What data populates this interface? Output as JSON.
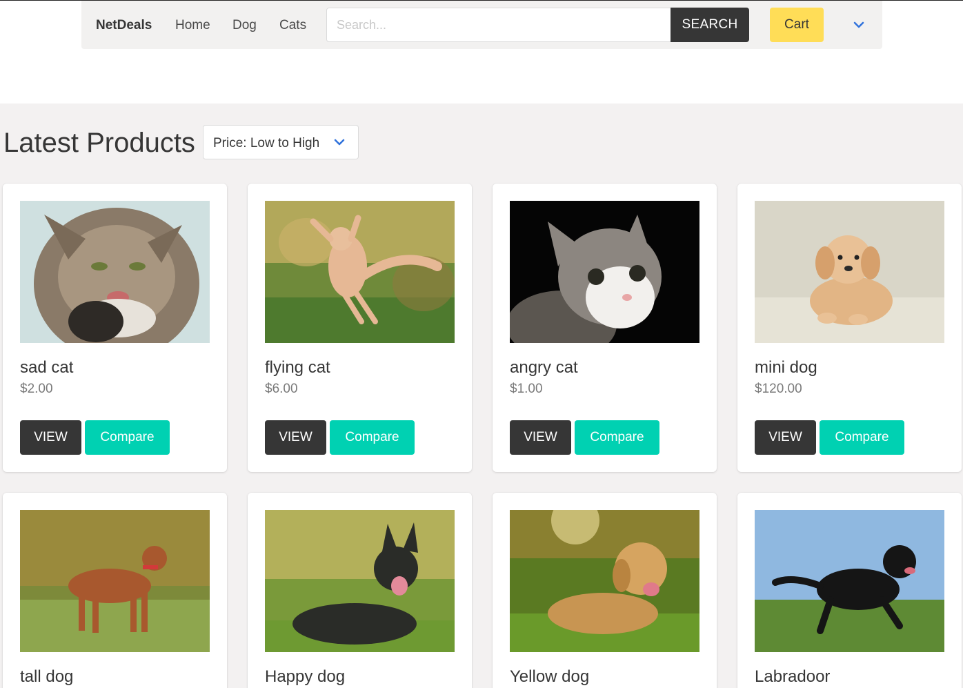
{
  "navbar": {
    "brand": "NetDeals",
    "links": [
      "Home",
      "Dog",
      "Cats"
    ],
    "search_placeholder": "Search...",
    "search_value": "",
    "search_button": "SEARCH",
    "cart_button": "Cart",
    "menu_icon": "chevron-down-icon"
  },
  "main": {
    "heading": "Latest Products",
    "sort": {
      "selected": "Price: Low to High",
      "icon": "chevron-down-icon"
    }
  },
  "products": [
    {
      "title": "sad cat",
      "price": "$2.00",
      "view": "VIEW",
      "compare": "Compare",
      "image": "cat-photo"
    },
    {
      "title": "flying cat",
      "price": "$6.00",
      "view": "VIEW",
      "compare": "Compare",
      "image": "cat-photo"
    },
    {
      "title": "angry cat",
      "price": "$1.00",
      "view": "VIEW",
      "compare": "Compare",
      "image": "cat-photo"
    },
    {
      "title": "mini dog",
      "price": "$120.00",
      "view": "VIEW",
      "compare": "Compare",
      "image": "dog-photo"
    },
    {
      "title": "tall dog",
      "image": "dog-photo"
    },
    {
      "title": "Happy dog",
      "image": "dog-photo"
    },
    {
      "title": "Yellow dog",
      "image": "dog-photo"
    },
    {
      "title": "Labradoor",
      "image": "dog-photo"
    }
  ],
  "colors": {
    "dark": "#363636",
    "teal": "#00d1b2",
    "yellow": "#ffdd57",
    "link_blue": "#3273dc",
    "page_bg": "#f3f1f1"
  }
}
